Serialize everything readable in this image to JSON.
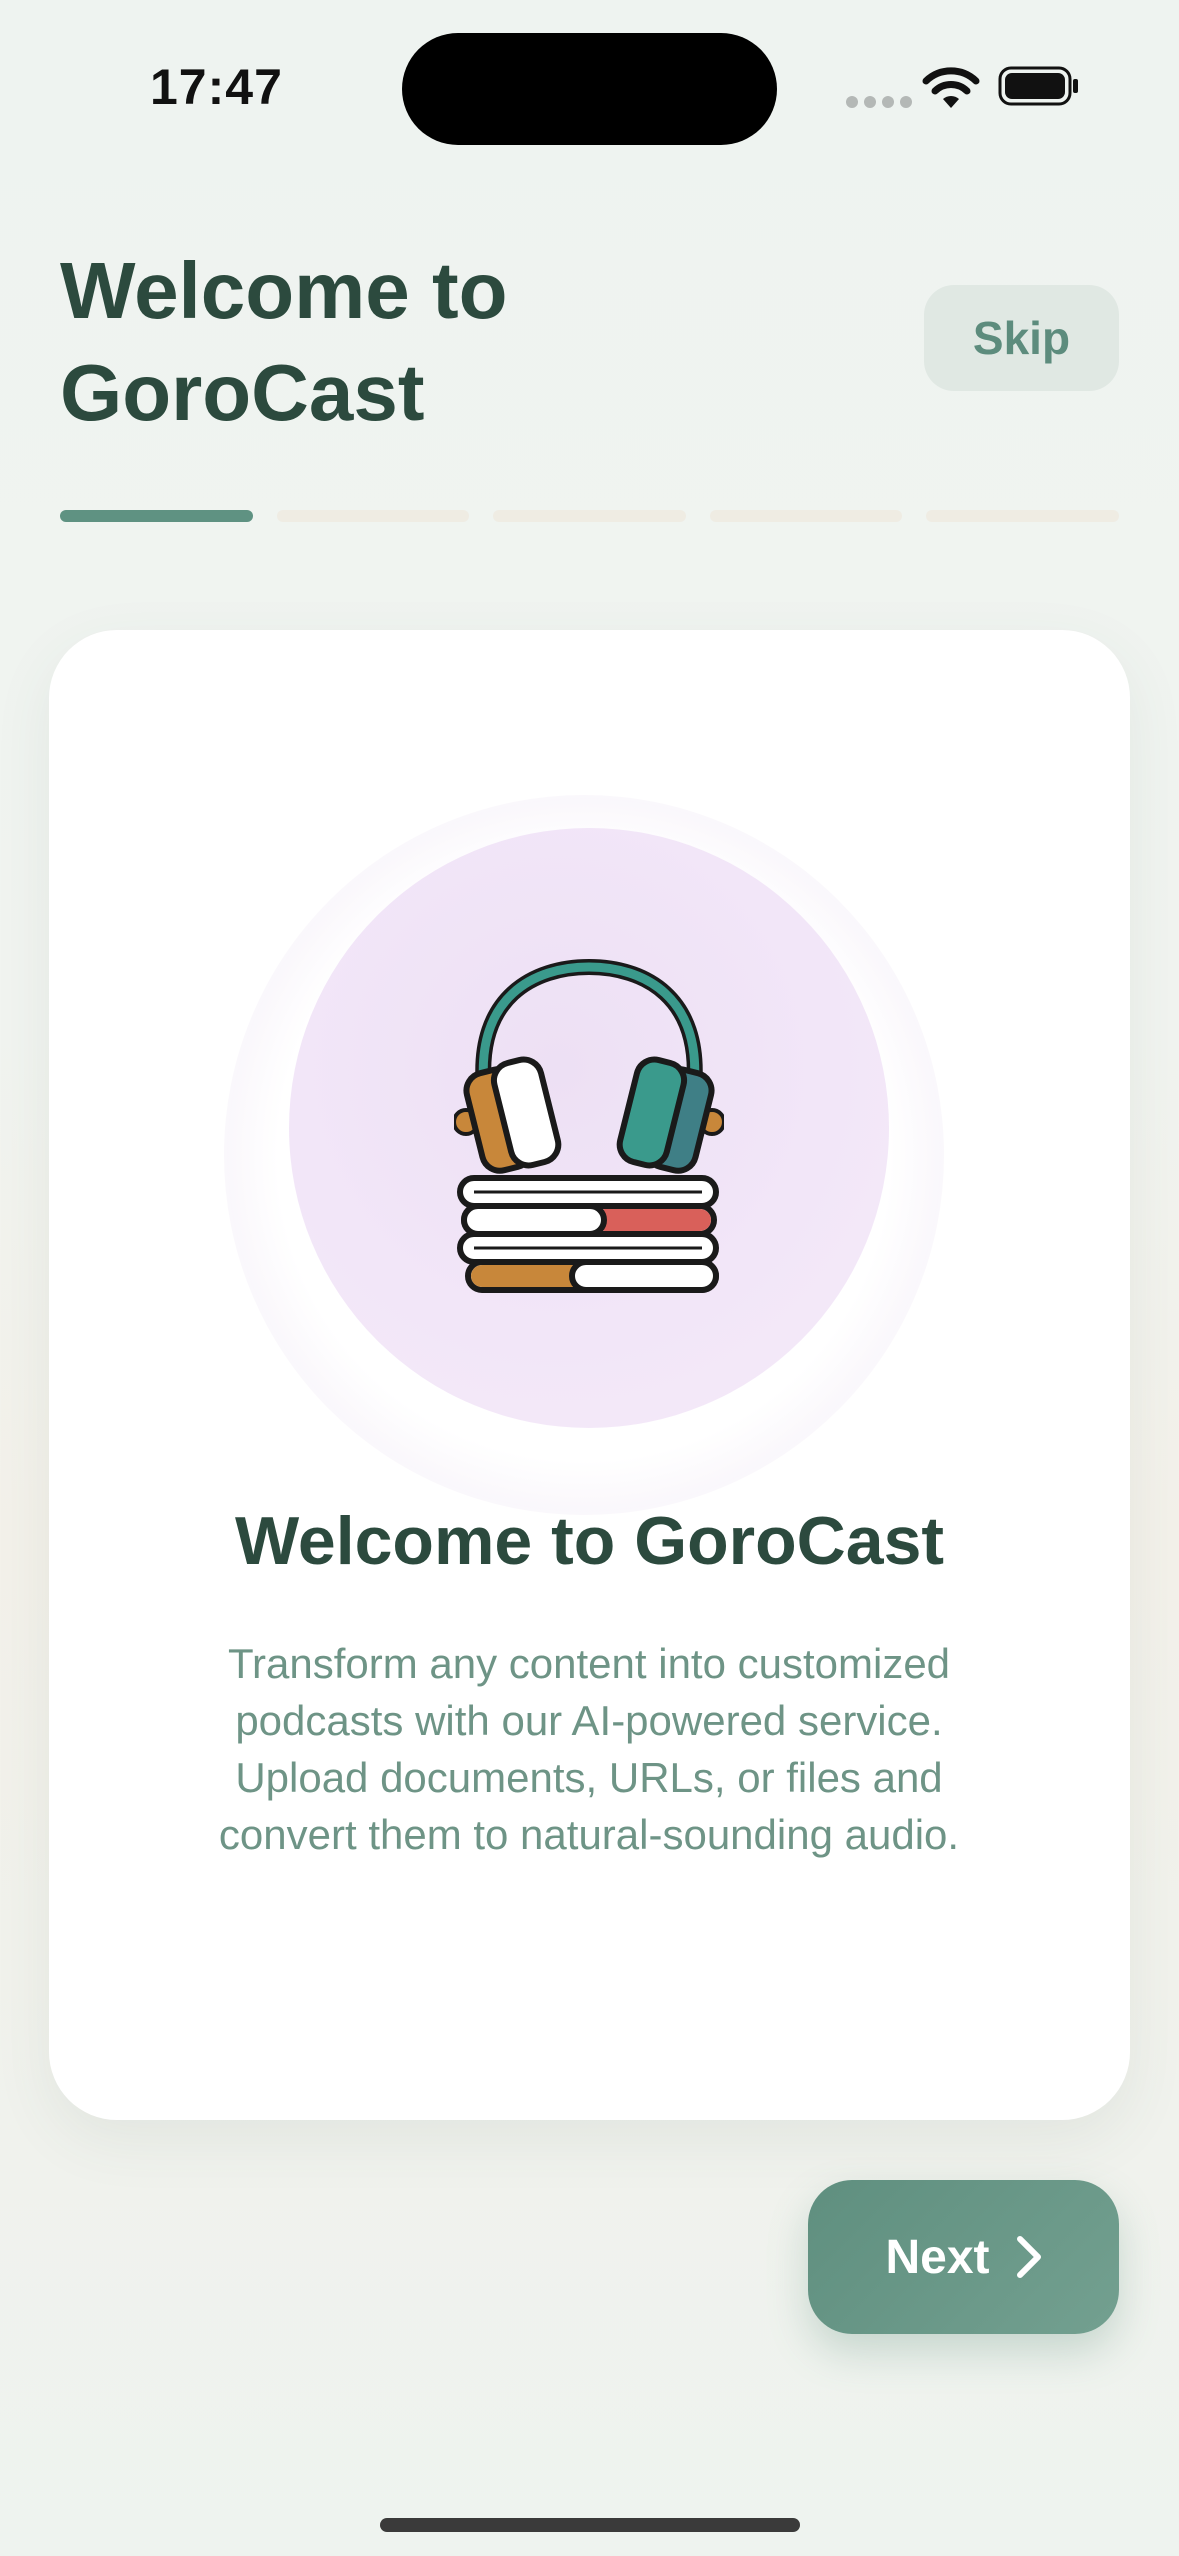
{
  "status_bar": {
    "time": "17:47"
  },
  "header": {
    "title": "Welcome to GoroCast",
    "skip_label": "Skip"
  },
  "progress": {
    "total_steps": 5,
    "current_step": 1
  },
  "card": {
    "illustration_icon": "headphones-on-books-icon",
    "heading": "Welcome to GoroCast",
    "body": "Transform any content into customized podcasts with our AI-powered service. Upload documents, URLs, or files and convert them to natural-sounding audio."
  },
  "footer": {
    "next_label": "Next",
    "next_icon": "chevron-right-icon"
  },
  "colors": {
    "accent": "#5f9282",
    "title": "#2c4a3e",
    "body_text": "#6e9486",
    "illustration_bg": "#f2e6f8"
  }
}
